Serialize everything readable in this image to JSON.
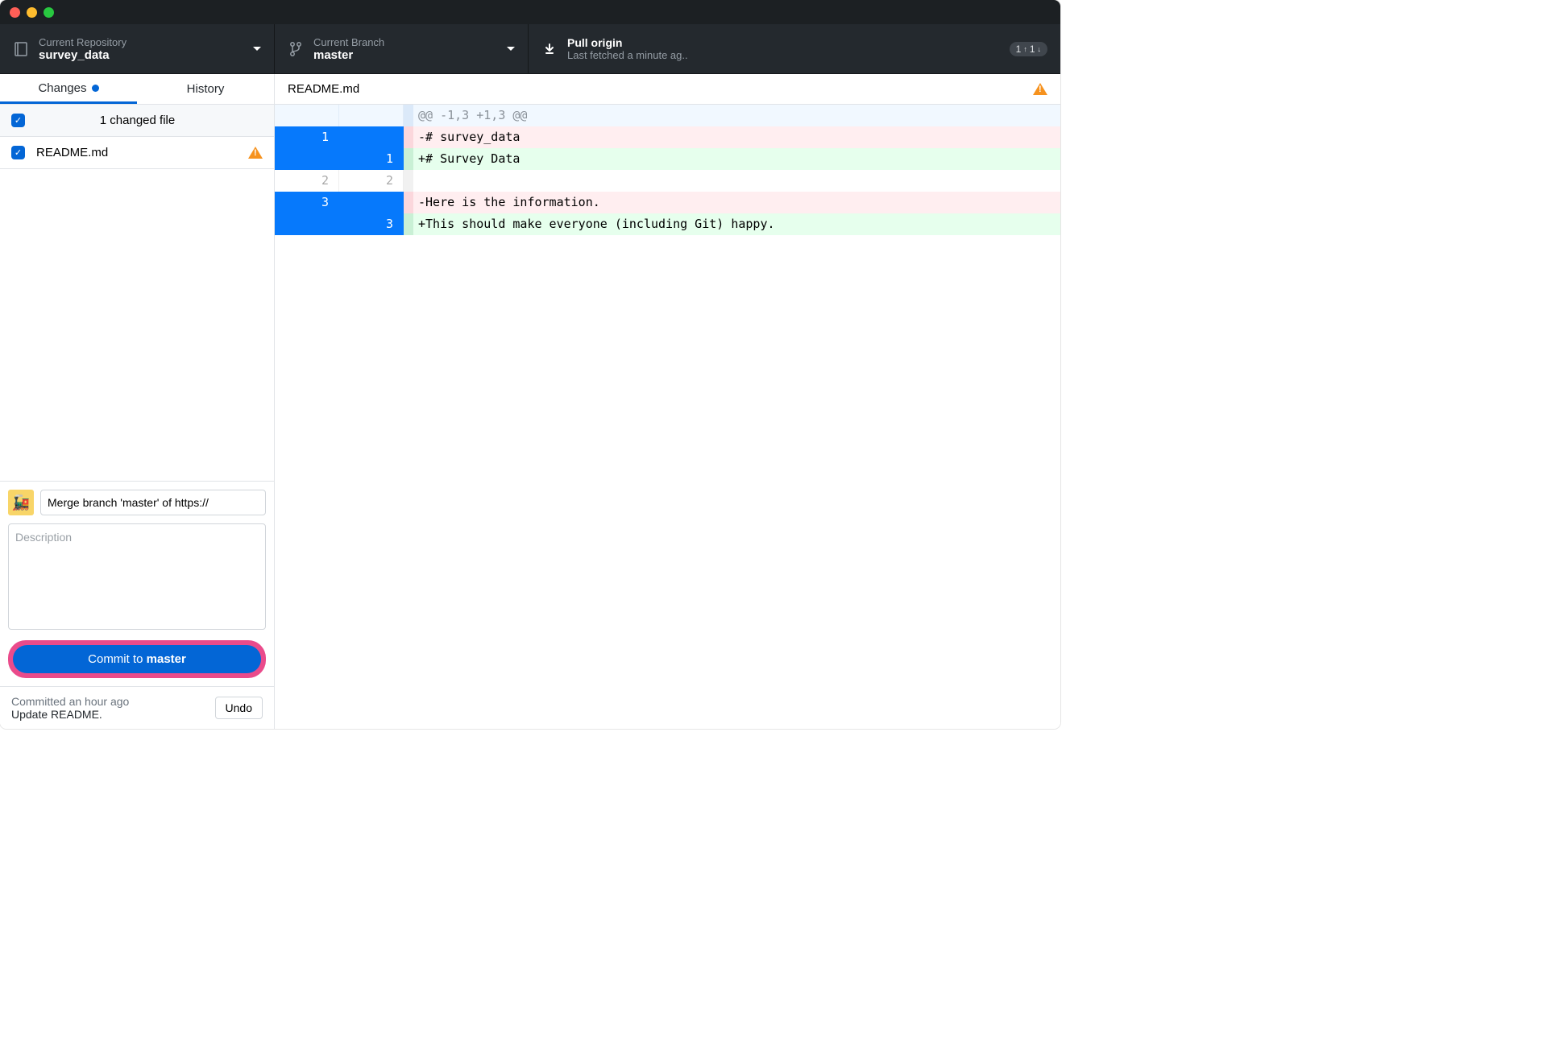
{
  "toolbar": {
    "repo": {
      "label": "Current Repository",
      "value": "survey_data"
    },
    "branch": {
      "label": "Current Branch",
      "value": "master"
    },
    "sync": {
      "title": "Pull origin",
      "subtitle": "Last fetched a minute ag..",
      "badge_up": "1",
      "badge_down": "1"
    }
  },
  "sidebar": {
    "tabs": {
      "changes": "Changes",
      "history": "History"
    },
    "changed_count": "1 changed file",
    "files": [
      {
        "name": "README.md",
        "warn": true
      }
    ]
  },
  "commit": {
    "summary_value": "Merge branch 'master' of https://",
    "description_placeholder": "Description",
    "button_prefix": "Commit to ",
    "button_branch": "master"
  },
  "last_commit": {
    "time": "Committed an hour ago",
    "message": "Update README.",
    "undo": "Undo"
  },
  "diff": {
    "filename": "README.md",
    "rows": [
      {
        "type": "hunk",
        "old": "",
        "new": "",
        "text": "@@ -1,3 +1,3 @@"
      },
      {
        "type": "del",
        "old": "1",
        "new": "",
        "text": "-# survey_data"
      },
      {
        "type": "add",
        "old": "",
        "new": "1",
        "text": "+# Survey Data"
      },
      {
        "type": "ctx",
        "old": "2",
        "new": "2",
        "text": ""
      },
      {
        "type": "del",
        "old": "3",
        "new": "",
        "text": "-Here is the information."
      },
      {
        "type": "add",
        "old": "",
        "new": "3",
        "text": "+This should make everyone (including Git) happy."
      }
    ]
  }
}
